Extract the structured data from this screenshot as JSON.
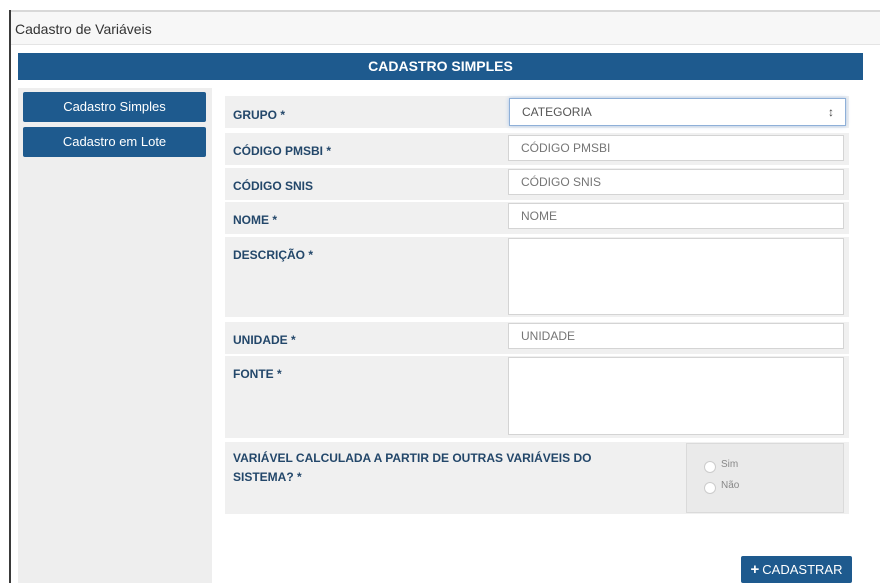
{
  "window": {
    "title": "Cadastro de Variáveis"
  },
  "banner": {
    "title": "CADASTRO SIMPLES"
  },
  "sidebar": {
    "items": [
      {
        "label": "Cadastro Simples"
      },
      {
        "label": "Cadastro em Lote"
      }
    ]
  },
  "form": {
    "grupo": {
      "label": "GRUPO *",
      "selected": "CATEGORIA"
    },
    "codigo_pmsbi": {
      "label": "CÓDIGO PMSBI *",
      "placeholder": "CÓDIGO PMSBI"
    },
    "codigo_snis": {
      "label": "CÓDIGO SNIS",
      "placeholder": "CÓDIGO SNIS"
    },
    "nome": {
      "label": "NOME *",
      "placeholder": "NOME"
    },
    "descricao": {
      "label": "DESCRIÇÃO *"
    },
    "unidade": {
      "label": "UNIDADE *",
      "placeholder": "UNIDADE"
    },
    "fonte": {
      "label": "FONTE *"
    },
    "calculada": {
      "label_line1": "VARIÁVEL CALCULADA A PARTIR DE OUTRAS VARIÁVEIS DO",
      "label_line2": "SISTEMA? *",
      "options": [
        {
          "label": "Sim"
        },
        {
          "label": "Não"
        }
      ]
    }
  },
  "submit": {
    "label": "CADASTRAR"
  },
  "colors": {
    "primary": "#1e5a8e",
    "label": "#23476a",
    "row_bg": "#f0f0f0"
  }
}
